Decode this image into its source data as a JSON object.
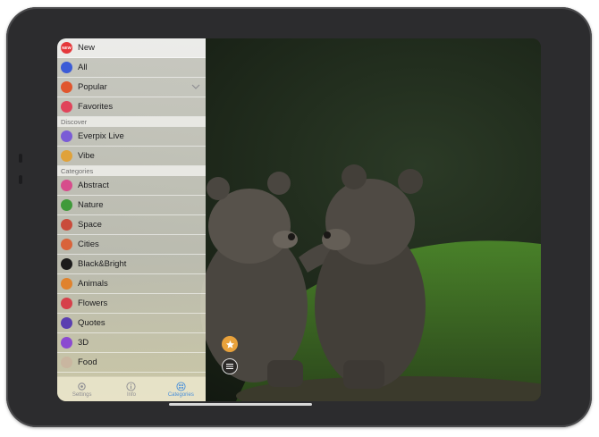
{
  "sidebar": {
    "top_items": [
      {
        "label": "New",
        "icon": "new-badge-icon",
        "color": "#e5383b",
        "badge": "NEW"
      },
      {
        "label": "All",
        "icon": "all-globe-icon",
        "color": "#3b5bd6"
      },
      {
        "label": "Popular",
        "icon": "popular-flame-icon",
        "color": "#e0552d"
      },
      {
        "label": "Favorites",
        "icon": "heart-icon",
        "color": "#e0445a"
      }
    ],
    "discover_header": "Discover",
    "discover_items": [
      {
        "label": "Everpix Live",
        "icon": "live-icon",
        "color": "#7a5cd6"
      },
      {
        "label": "Vibe",
        "icon": "vibe-face-icon",
        "color": "#e0a23a"
      }
    ],
    "categories_header": "Categories",
    "category_items": [
      {
        "label": "Abstract",
        "icon": "abstract-icon",
        "color": "#d74c8c"
      },
      {
        "label": "Nature",
        "icon": "leaf-icon",
        "color": "#3f9a3a"
      },
      {
        "label": "Space",
        "icon": "rocket-icon",
        "color": "#c94b3b"
      },
      {
        "label": "Cities",
        "icon": "city-icon",
        "color": "#d9633a"
      },
      {
        "label": "Black&Bright",
        "icon": "black-bright-icon",
        "color": "#1c1c1c"
      },
      {
        "label": "Animals",
        "icon": "animal-icon",
        "color": "#e0822d"
      },
      {
        "label": "Flowers",
        "icon": "flower-icon",
        "color": "#d6404a"
      },
      {
        "label": "Quotes",
        "icon": "quote-icon",
        "color": "#5a3fb0"
      },
      {
        "label": "3D",
        "icon": "cube-icon",
        "color": "#8b4ad1"
      },
      {
        "label": "Food",
        "icon": "food-icon",
        "color": "#c9b6a0"
      }
    ]
  },
  "tabs": [
    {
      "label": "Settings",
      "icon": "gear-icon"
    },
    {
      "label": "Info",
      "icon": "info-icon"
    },
    {
      "label": "Categories",
      "icon": "categories-icon",
      "active": true
    }
  ],
  "accent_color": "#4a90d9"
}
